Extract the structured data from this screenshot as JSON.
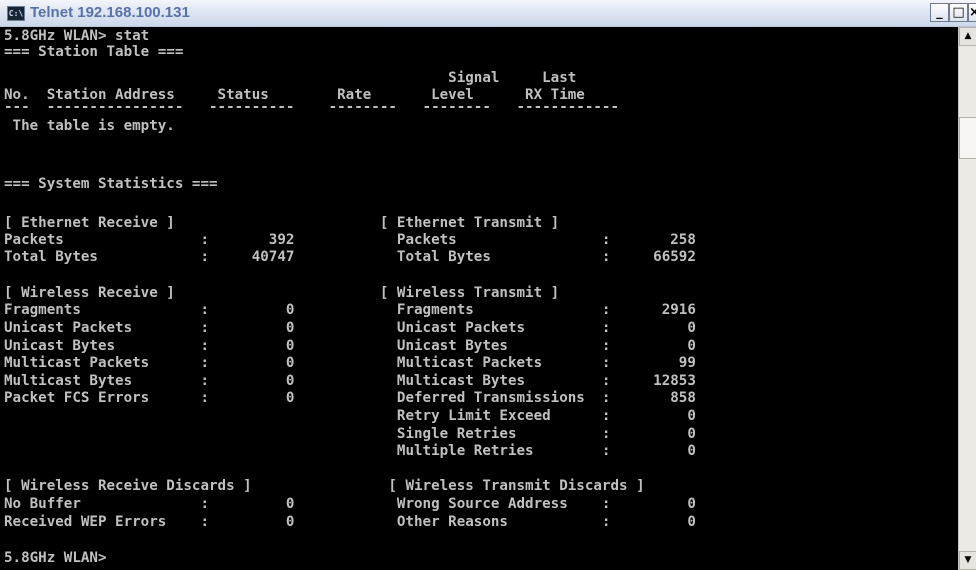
{
  "window": {
    "title": "Telnet 192.168.100.131",
    "icon_text": "C:\\",
    "minimize_glyph": "_",
    "maximize_glyph": "□",
    "close_glyph": "×"
  },
  "console": {
    "lines": [
      "5.8GHz WLAN> stat",
      "=== Station Table ===",
      "                                                    Signal     Last",
      "No.  Station Address     Status        Rate       Level      RX Time",
      "---  ----------------   ----------    --------   --------   ------------",
      " The table is empty.",
      "=== System Statistics ===",
      "[ Ethernet Receive ]                        [ Ethernet Transmit ]",
      "Packets                :       392            Packets                 :       258",
      "Total Bytes            :     40747            Total Bytes             :     66592",
      "[ Wireless Receive ]                        [ Wireless Transmit ]",
      "Fragments              :         0            Fragments               :      2916",
      "Unicast Packets        :         0            Unicast Packets         :         0",
      "Unicast Bytes          :         0            Unicast Bytes           :         0",
      "Multicast Packets      :         0            Multicast Packets       :        99",
      "Multicast Bytes        :         0            Multicast Bytes         :     12853",
      "Packet FCS Errors      :         0            Deferred Transmissions  :       858",
      "                                              Retry Limit Exceed      :         0",
      "                                              Single Retries          :         0",
      "                                              Multiple Retries        :         0",
      "[ Wireless Receive Discards ]                [ Wireless Transmit Discards ]",
      "No Buffer              :         0            Wrong Source Address    :         0",
      "Received WEP Errors    :         0            Other Reasons           :         0",
      "5.8GHz WLAN>"
    ]
  },
  "scrollbar": {
    "up_glyph": "▲",
    "down_glyph": "▼"
  }
}
